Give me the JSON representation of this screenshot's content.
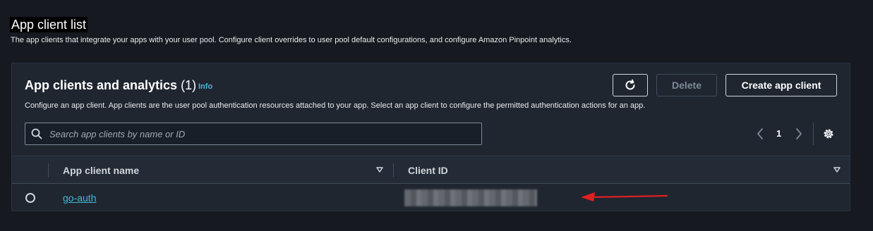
{
  "page": {
    "title": "App client list",
    "description": "The app clients that integrate your apps with your user pool. Configure client overrides to user pool default configurations, and configure Amazon Pinpoint analytics."
  },
  "panel": {
    "title": "App clients and analytics",
    "count": "(1)",
    "info_label": "Info",
    "description": "Configure an app client. App clients are the user pool authentication resources attached to your app. Select an app client to configure the permitted authentication actions for an app.",
    "refresh_icon": "refresh-icon",
    "delete_label": "Delete",
    "create_label": "Create app client"
  },
  "search": {
    "placeholder": "Search app clients by name or ID",
    "value": "",
    "icon": "search-icon"
  },
  "pagination": {
    "current_page": "1",
    "prev_icon": "chevron-left-icon",
    "next_icon": "chevron-right-icon",
    "settings_icon": "gear-icon"
  },
  "table": {
    "columns": [
      {
        "label": "App client name",
        "sort_icon": "caret-down-icon"
      },
      {
        "label": "Client ID",
        "sort_icon": "caret-down-icon"
      }
    ],
    "rows": [
      {
        "name": "go-auth",
        "client_id": ""
      }
    ]
  },
  "annotation": {
    "color": "#e02020",
    "icon": "arrow-left-icon"
  },
  "colors": {
    "accent_link": "#44b9d6",
    "background": "#16191f",
    "panel": "#1f2630"
  }
}
